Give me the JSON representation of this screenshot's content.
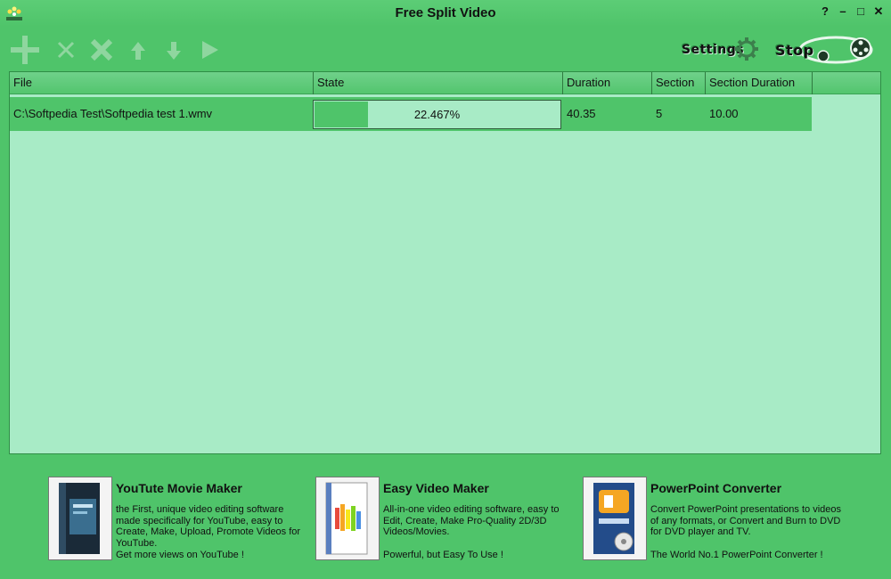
{
  "window": {
    "title": "Free Split Video",
    "controls": [
      "?",
      "–",
      "□",
      "✕"
    ]
  },
  "toolbar": {
    "icons": [
      "add-icon",
      "remove-icon",
      "clear-icon",
      "move-up-icon",
      "move-down-icon",
      "play-icon"
    ],
    "settings_label": "Settings",
    "stop_label": "Stop"
  },
  "grid": {
    "columns": [
      "File",
      "State",
      "Duration",
      "Section",
      "Section Duration"
    ],
    "rows": [
      {
        "file": "C:\\Softpedia Test\\Softpedia test 1.wmv",
        "state": "22.467%",
        "progress": 0.22467,
        "duration": "40.35",
        "section": "5",
        "section_duration": "10.00"
      }
    ]
  },
  "promos": [
    {
      "title": "YouTute Movie Maker",
      "desc": "the First, unique video editing software made specifically for YouTube, easy to Create, Make, Upload, Promote Videos for YouTube.",
      "tagline": "Get more views on YouTube !"
    },
    {
      "title": "Easy Video Maker",
      "desc": "All-in-one video editing software, easy to Edit, Create, Make Pro-Quality 2D/3D Videos/Movies.",
      "tagline": "Powerful, but Easy To Use !"
    },
    {
      "title": "PowerPoint Converter",
      "desc": "Convert PowerPoint presentations to videos of any formats, or Convert and Burn to DVD for DVD player and TV.",
      "tagline": "The World No.1 PowerPoint Converter !"
    }
  ],
  "colors": {
    "background": "#4fc46a",
    "grid_background": "#a8ebc6",
    "disabled_icon": "#8fd69f"
  }
}
